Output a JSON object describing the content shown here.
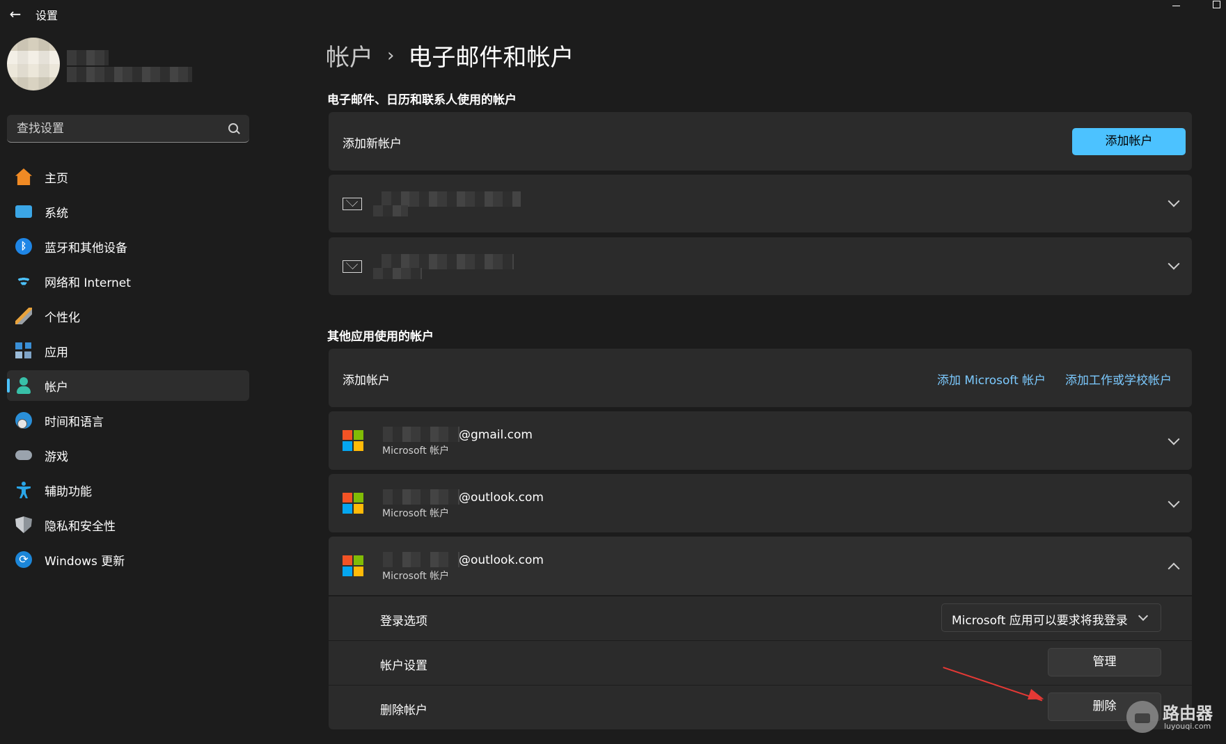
{
  "app": {
    "title": "设置",
    "back_icon": "back-arrow-icon"
  },
  "search": {
    "placeholder": "查找设置"
  },
  "nav": {
    "items": [
      {
        "label": "主页",
        "icon": "home-icon"
      },
      {
        "label": "系统",
        "icon": "system-icon"
      },
      {
        "label": "蓝牙和其他设备",
        "icon": "bluetooth-icon"
      },
      {
        "label": "网络和 Internet",
        "icon": "wifi-icon"
      },
      {
        "label": "个性化",
        "icon": "brush-icon"
      },
      {
        "label": "应用",
        "icon": "apps-icon"
      },
      {
        "label": "帐户",
        "icon": "account-icon",
        "active": true
      },
      {
        "label": "时间和语言",
        "icon": "time-language-icon"
      },
      {
        "label": "游戏",
        "icon": "gamepad-icon"
      },
      {
        "label": "辅助功能",
        "icon": "accessibility-icon"
      },
      {
        "label": "隐私和安全性",
        "icon": "shield-icon"
      },
      {
        "label": "Windows 更新",
        "icon": "update-icon"
      }
    ]
  },
  "breadcrumb": {
    "parent": "帐户",
    "separator": "›",
    "current": "电子邮件和帐户"
  },
  "email_section": {
    "title": "电子邮件、日历和联系人使用的帐户",
    "add_label": "添加新帐户",
    "add_button": "添加帐户"
  },
  "other_section": {
    "title": "其他应用使用的帐户",
    "add_label": "添加帐户",
    "link_microsoft": "添加 Microsoft 帐户",
    "link_work": "添加工作或学校帐户"
  },
  "ms_accounts": [
    {
      "email_suffix": "@gmail.com",
      "type": "Microsoft 帐户",
      "expanded": false
    },
    {
      "email_suffix": "@outlook.com",
      "type": "Microsoft 帐户",
      "expanded": false
    },
    {
      "email_suffix": "@outlook.com",
      "type": "Microsoft 帐户",
      "expanded": true
    }
  ],
  "expanded_options": {
    "signin_label": "登录选项",
    "signin_value": "Microsoft 应用可以要求将我登录",
    "settings_label": "帐户设置",
    "manage_button": "管理",
    "delete_label": "删除帐户",
    "delete_button": "删除"
  },
  "watermark": {
    "text": "路由器",
    "sub": "luyouqi.com"
  },
  "colors": {
    "accent": "#4cc2ff",
    "background": "#1c1c1c",
    "card": "#2b2b2b",
    "link": "#7ccaff",
    "annotation_arrow": "#e53935"
  }
}
